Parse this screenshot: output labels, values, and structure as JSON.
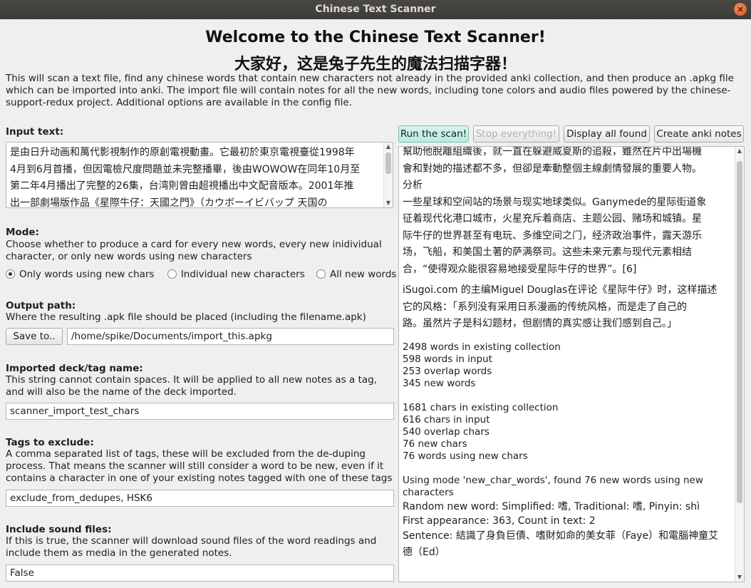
{
  "window": {
    "title": "Chinese Text Scanner",
    "close_glyph": "×"
  },
  "header": {
    "title_en": "Welcome to the Chinese Text Scanner!",
    "title_zh": "大家好，这是兔子先生的魔法扫描字器！",
    "intro": "This will scan a text file, find any chinese words that contain new characters not already in the provided anki collection, and then produce an .apkg file which can be imported into anki. The import file will contain notes for all the new words, including tone colors and audio files powered by the chinese-support-redux project. Additional options are available in the config file."
  },
  "input_text": {
    "label": "Input text:",
    "lines": [
      "是由日升动画和萬代影視制作的原創電視動畫。它最初於東京電視臺從1998年",
      "4月到6月首播，但因電檢尺度問題並未完整播畢，後由WOWOW在同年10月至",
      "第二年4月播出了完整的26集，台湾則曾由超視播出中文配音版本。2001年推",
      "出一部劇場版作品《星際牛仔：天國之門》（カウボーイビバップ 天国の"
    ]
  },
  "mode": {
    "label": "Mode:",
    "description": "Choose whether to produce a card for every new words, every new inidividual character, or only new words using new characters",
    "options": [
      {
        "label": "Only words using new chars",
        "selected": true
      },
      {
        "label": "Individual new characters",
        "selected": false
      },
      {
        "label": "All new words",
        "selected": false
      }
    ]
  },
  "output_path": {
    "label": "Output path:",
    "description": "Where the resulting .apk file should be placed (including the filename.apk)",
    "button": "Save to..",
    "value": "/home/spike/Documents/import_this.apkg"
  },
  "deck_tag": {
    "label": "Imported deck/tag name:",
    "description": "This string cannot contain spaces. It will be applied to all new notes as a tag, and will also be the name of the deck imported.",
    "value": "scanner_import_test_chars"
  },
  "tags_exclude": {
    "label": "Tags to exclude:",
    "description": "A comma separated list of tags, these will be excluded from the de-duping process. That means the scanner will still consider a word to be new, even if it contains a character in one of your existing notes tagged with one of these tags",
    "value": "exclude_from_dedupes, HSK6"
  },
  "sound": {
    "label": "Include sound files:",
    "description": "If this is true, the scanner will download sound files of the word readings and include them as media in the generated notes.",
    "value": "False"
  },
  "toolbar": {
    "run": "Run the scan!",
    "stop": "Stop everything!",
    "display": "Display all found",
    "create": "Create anki notes"
  },
  "output": {
    "cjk_lines": [
      "幫助他脫離組織後，就一直在躲避威夏斯的追殺，雖然在片中出場機",
      "會和對她的描述都不多，但卻是牽動整個主線劇情發展的重要人物。",
      "分析",
      "一些星球和空间站的场景与现实地球类似。Ganymede的星际街道象",
      "征着现代化港口城市，火星充斥着商店、主题公园、赌场和城镇。星",
      "际牛仔的世界甚至有电玩、多维空间之门，经济政治事件，露天游乐",
      "场，飞船，和美国土著的萨满祭司。这些未来元素与现代元素相结",
      "合，“使得观众能很容易地接受星际牛仔的世界”。[6]"
    ],
    "quote_lines": [
      "iSugoi.com 的主编Miguel Douglas在评论《星际牛仔》时，这样描述",
      "它的风格：「系列没有采用日系漫画的传统风格，而是走了自己的",
      "路。虽然片子是科幻题材，但剧情的真实感让我们感到自己。」"
    ],
    "words_stats": [
      "2498 words in existing collection",
      "598 words in input",
      "253 overlap words",
      "345 new words"
    ],
    "chars_stats": [
      "1681 chars in existing collection",
      "616 chars in input",
      "540 overlap chars",
      "76 new chars",
      "76 words using new chars"
    ],
    "mode_line": "Using mode 'new_char_words', found 76 new words using new characters",
    "random_word": "Random new word: Simplified: 嗜, Traditional: 嗜, Pinyin: shì",
    "first_appearance": "First appearance: 363, Count in text: 2",
    "sentence_lines": [
      "Sentence: 結識了身負巨債、嗜財如命的美女菲（Faye）和電腦神童艾",
      "德（Ed）"
    ]
  }
}
